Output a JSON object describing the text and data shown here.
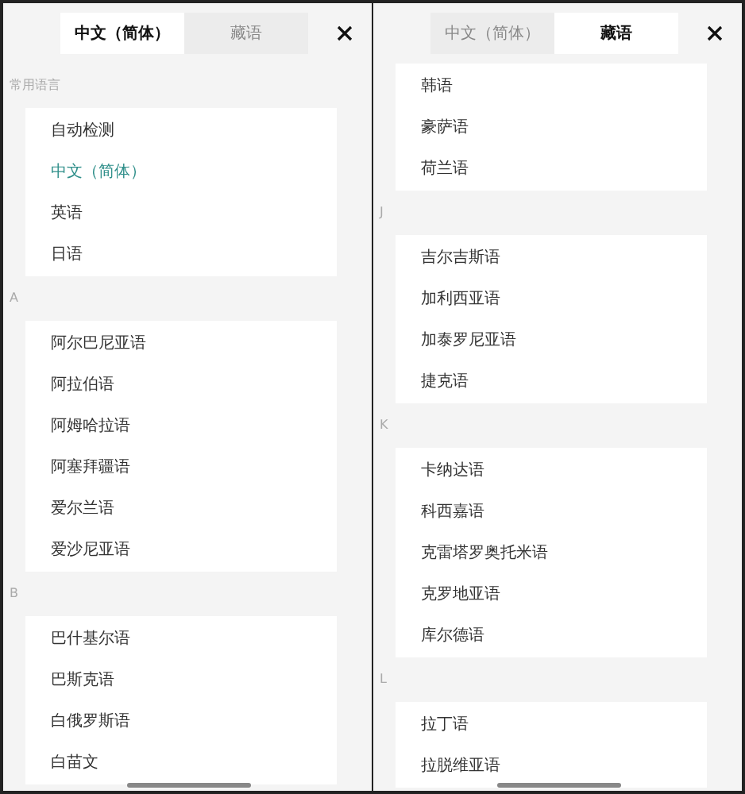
{
  "panels": [
    {
      "tabs": [
        {
          "label": "中文（简体）",
          "selected": true
        },
        {
          "label": "藏语",
          "selected": false
        }
      ],
      "groups": [
        {
          "header": "常用语言",
          "items": [
            {
              "label": "自动检测",
              "selected": false
            },
            {
              "label": "中文（简体）",
              "selected": true
            },
            {
              "label": "英语",
              "selected": false
            },
            {
              "label": "日语",
              "selected": false
            }
          ]
        },
        {
          "header": "A",
          "items": [
            {
              "label": "阿尔巴尼亚语",
              "selected": false
            },
            {
              "label": "阿拉伯语",
              "selected": false
            },
            {
              "label": "阿姆哈拉语",
              "selected": false
            },
            {
              "label": "阿塞拜疆语",
              "selected": false
            },
            {
              "label": "爱尔兰语",
              "selected": false
            },
            {
              "label": "爱沙尼亚语",
              "selected": false
            }
          ]
        },
        {
          "header": "B",
          "items": [
            {
              "label": "巴什基尔语",
              "selected": false
            },
            {
              "label": "巴斯克语",
              "selected": false
            },
            {
              "label": "白俄罗斯语",
              "selected": false
            },
            {
              "label": "白苗文",
              "selected": false
            }
          ]
        }
      ]
    },
    {
      "tabs": [
        {
          "label": "中文（简体）",
          "selected": false
        },
        {
          "label": "藏语",
          "selected": true
        }
      ],
      "groups": [
        {
          "items": [
            {
              "label": "韩语",
              "selected": false
            },
            {
              "label": "豪萨语",
              "selected": false
            },
            {
              "label": "荷兰语",
              "selected": false
            }
          ]
        },
        {
          "header": "J",
          "items": [
            {
              "label": "吉尔吉斯语",
              "selected": false
            },
            {
              "label": "加利西亚语",
              "selected": false
            },
            {
              "label": "加泰罗尼亚语",
              "selected": false
            },
            {
              "label": "捷克语",
              "selected": false
            }
          ]
        },
        {
          "header": "K",
          "items": [
            {
              "label": "卡纳达语",
              "selected": false
            },
            {
              "label": "科西嘉语",
              "selected": false
            },
            {
              "label": "克雷塔罗奥托米语",
              "selected": false
            },
            {
              "label": "克罗地亚语",
              "selected": false
            },
            {
              "label": "库尔德语",
              "selected": false
            }
          ]
        },
        {
          "header": "L",
          "items": [
            {
              "label": "拉丁语",
              "selected": false
            },
            {
              "label": "拉脱维亚语",
              "selected": false
            }
          ]
        }
      ]
    }
  ]
}
